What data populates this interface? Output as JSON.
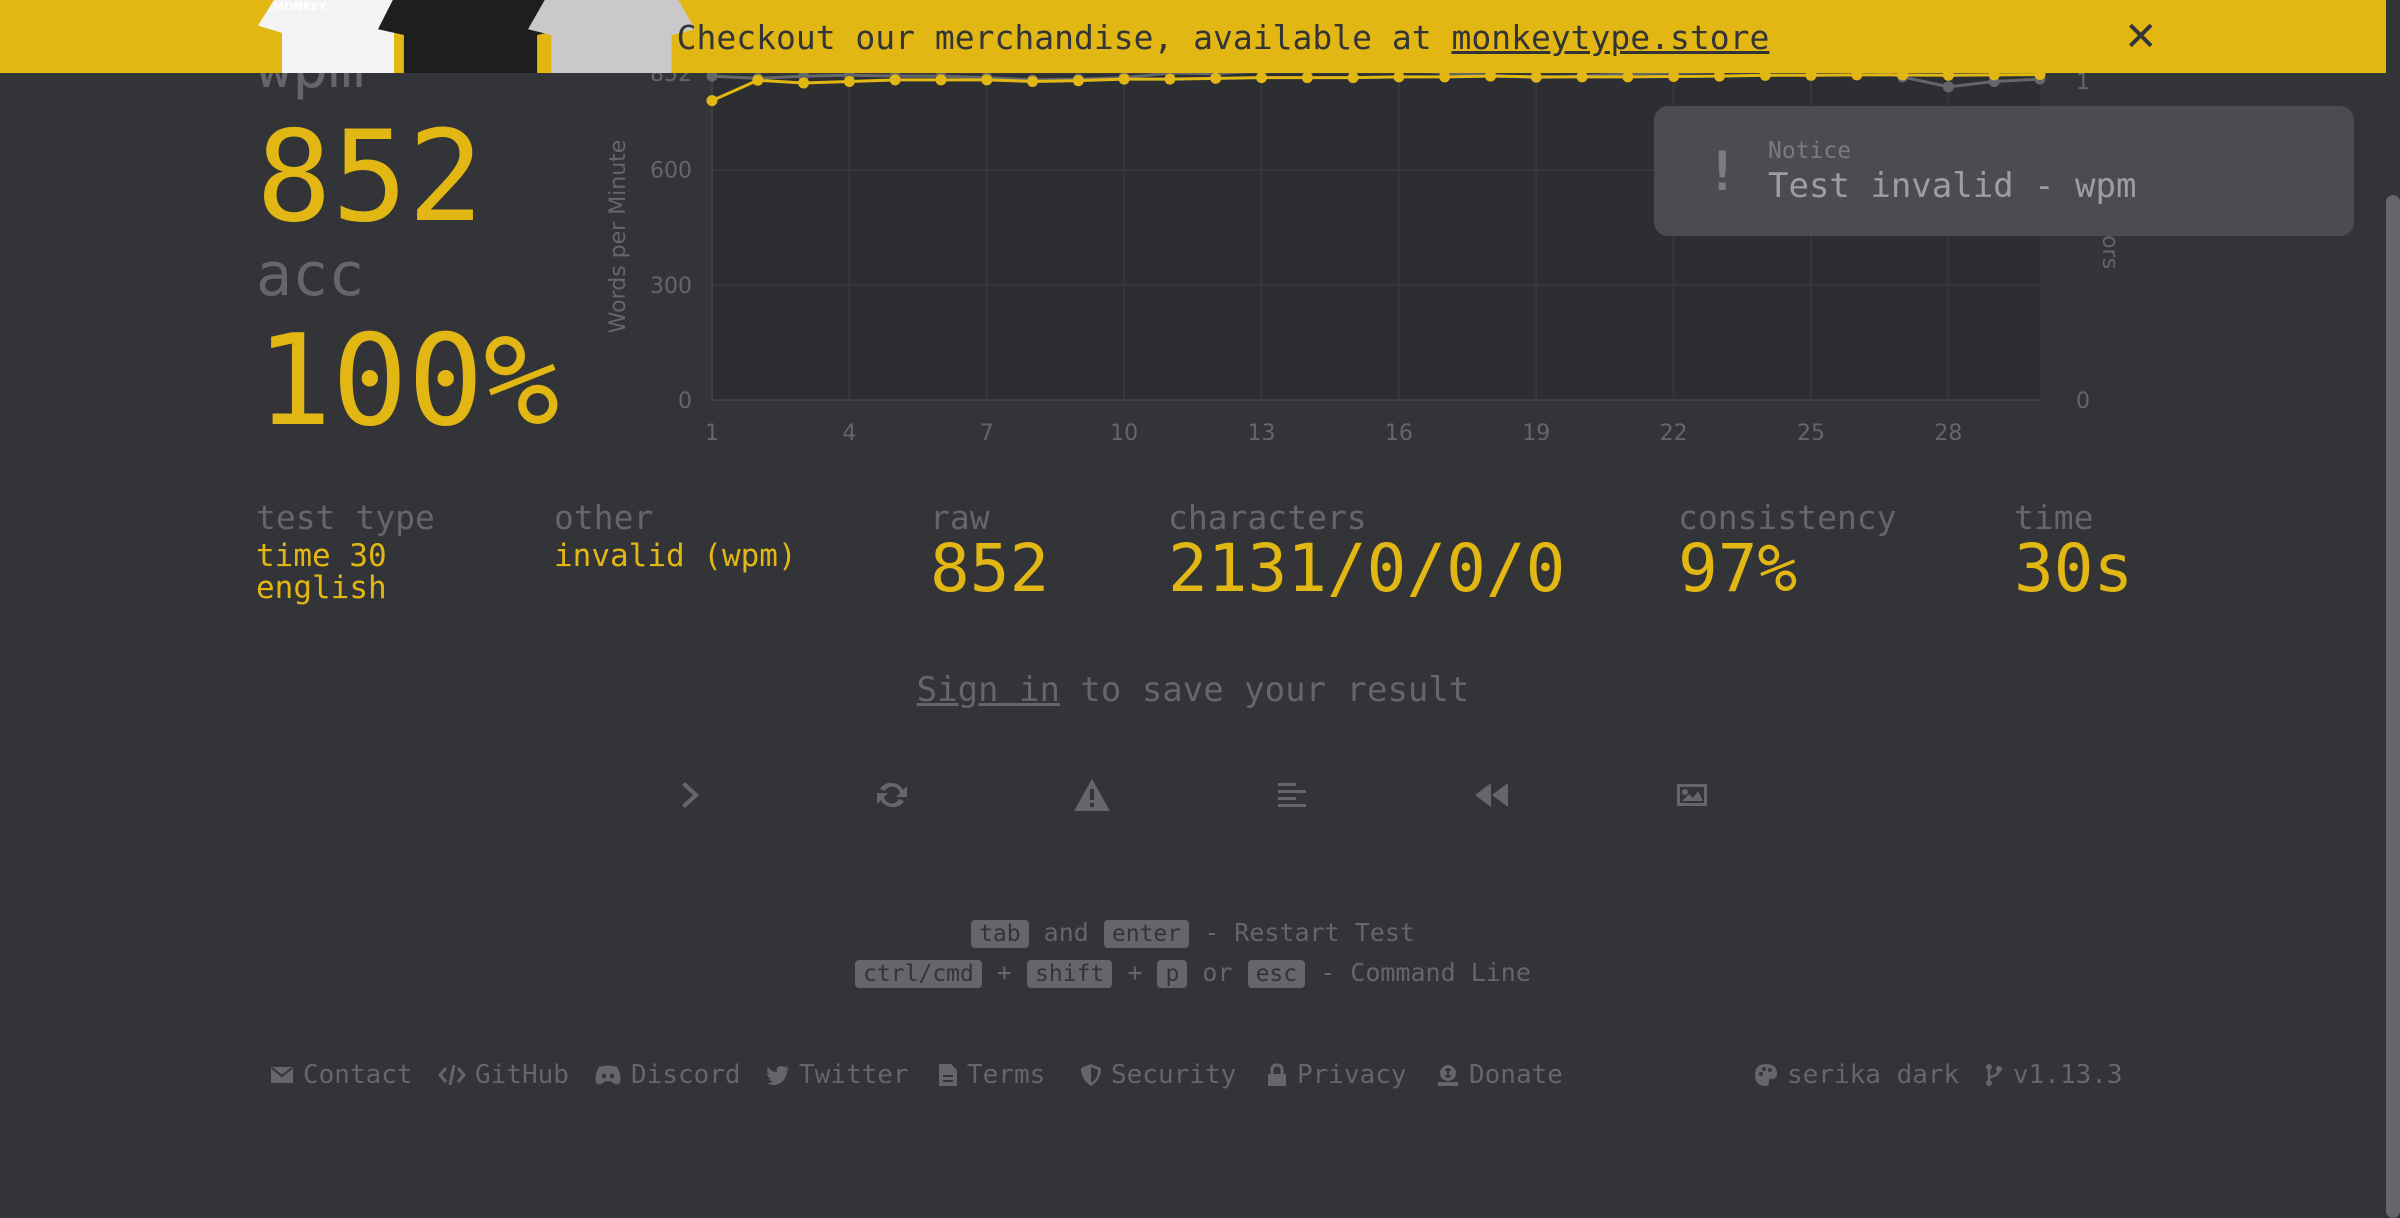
{
  "banner": {
    "text": "Checkout our merchandise, available at ",
    "link": "monkeytype.store",
    "close": "✕",
    "shirt_text": "MONKEY"
  },
  "stats": {
    "wpm_label": "wpm",
    "wpm_value": "852",
    "acc_label": "acc",
    "acc_value": "100%"
  },
  "notice": {
    "icon": "!",
    "title": "Notice",
    "message": "Test invalid - wpm"
  },
  "info": {
    "test_type_label": "test type",
    "test_type_line1": "time 30",
    "test_type_line2": "english",
    "other_label": "other",
    "other_value": "invalid (wpm)",
    "raw_label": "raw",
    "raw_value": "852",
    "characters_label": "characters",
    "characters_value": "2131/0/0/0",
    "consistency_label": "consistency",
    "consistency_value": "97%",
    "time_label": "time",
    "time_value": "30s"
  },
  "signin": {
    "link": "Sign in",
    "text": " to save your result"
  },
  "actions": [
    {
      "icon": "next-test-icon"
    },
    {
      "icon": "restart-icon"
    },
    {
      "icon": "report-warning-icon"
    },
    {
      "icon": "words-history-icon"
    },
    {
      "icon": "replay-icon"
    },
    {
      "icon": "screenshot-icon"
    }
  ],
  "hints": {
    "line1": {
      "k1": "tab",
      "and": "and",
      "k2": "enter",
      "action": "- Restart Test"
    },
    "line2": {
      "k1": "ctrl/cmd",
      "plus1": "+",
      "k2": "shift",
      "plus2": "+",
      "k3": "p",
      "or": "or",
      "k4": "esc",
      "action": "- Command Line"
    }
  },
  "footer": {
    "contact": "Contact",
    "github": "GitHub",
    "discord": "Discord",
    "twitter": "Twitter",
    "terms": "Terms",
    "security": "Security",
    "privacy": "Privacy",
    "donate": "Donate",
    "theme": "serika dark",
    "version": "v1.13.3"
  },
  "colors": {
    "background": "#323437",
    "main": "#e2b714",
    "sub": "#646669"
  },
  "chart_data": {
    "type": "line",
    "ylabel": "Words per Minute",
    "right_ylabel": "Errors",
    "x_ticks": [
      1,
      4,
      7,
      10,
      13,
      16,
      19,
      22,
      25,
      28
    ],
    "y_ticks": [
      0,
      300,
      600,
      852
    ],
    "right_ticks": [
      0,
      1
    ],
    "xlim": [
      1,
      30
    ],
    "ylim": [
      0,
      852
    ],
    "x": [
      1,
      2,
      3,
      4,
      5,
      6,
      7,
      8,
      9,
      10,
      11,
      12,
      13,
      14,
      15,
      16,
      17,
      18,
      19,
      20,
      21,
      22,
      23,
      24,
      25,
      26,
      27,
      28,
      29,
      30
    ],
    "series": [
      {
        "role": "wpm",
        "color": "#e2b714",
        "values": [
          780,
          833,
          826,
          830,
          834,
          834,
          834,
          830,
          832,
          836,
          836,
          838,
          840,
          840,
          840,
          842,
          842,
          844,
          842,
          842,
          842,
          843,
          844,
          846,
          846,
          847,
          847,
          846,
          847,
          848
        ]
      },
      {
        "role": "raw",
        "color": "#646669",
        "values": [
          844,
          838,
          844,
          846,
          844,
          844,
          840,
          834,
          836,
          840,
          852,
          850,
          858,
          856,
          860,
          862,
          852,
          846,
          840,
          844,
          850,
          852,
          856,
          872,
          874,
          866,
          842,
          816,
          830,
          836
        ]
      }
    ]
  }
}
